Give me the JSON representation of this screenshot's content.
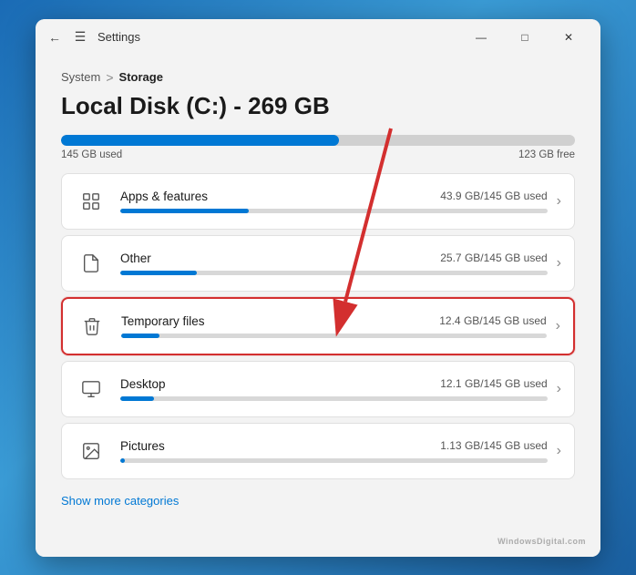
{
  "window": {
    "title": "Settings",
    "controls": {
      "minimize": "—",
      "maximize": "□",
      "close": "✕"
    }
  },
  "breadcrumb": {
    "parent": "System",
    "separator": ">",
    "current": "Storage"
  },
  "page_title": "Local Disk (C:) - 269 GB",
  "storage": {
    "used_label": "145 GB used",
    "free_label": "123 GB free",
    "used_percent": 54
  },
  "categories": [
    {
      "name": "Apps & features",
      "size": "43.9 GB/145 GB used",
      "percent": 30,
      "icon": "apps"
    },
    {
      "name": "Other",
      "size": "25.7 GB/145 GB used",
      "percent": 18,
      "icon": "other"
    },
    {
      "name": "Temporary files",
      "size": "12.4 GB/145 GB used",
      "percent": 9,
      "icon": "trash",
      "highlighted": true
    },
    {
      "name": "Desktop",
      "size": "12.1 GB/145 GB used",
      "percent": 8,
      "icon": "desktop"
    },
    {
      "name": "Pictures",
      "size": "1.13 GB/145 GB used",
      "percent": 1,
      "icon": "pictures"
    }
  ],
  "show_more": "Show more categories",
  "watermark": "WindowsDigital.com"
}
